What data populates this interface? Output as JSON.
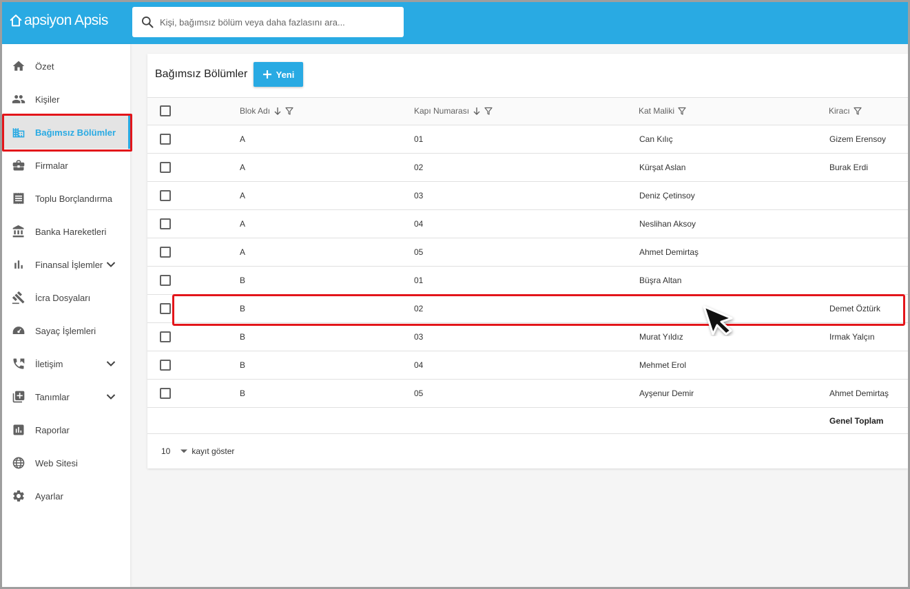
{
  "app": {
    "logo_text": "apsiyon Apsis",
    "brand_color": "#29aae3",
    "highlight_color": "#e3151a"
  },
  "search": {
    "placeholder": "Kişi, bağımsız bölüm veya daha fazlasını ara..."
  },
  "sidebar": {
    "items": [
      {
        "label": "Özet",
        "icon": "home-icon"
      },
      {
        "label": "Kişiler",
        "icon": "people-icon"
      },
      {
        "label": "Bağımsız Bölümler",
        "icon": "building-icon",
        "active": true
      },
      {
        "label": "Firmalar",
        "icon": "briefcase-icon"
      },
      {
        "label": "Toplu Borçlandırma",
        "icon": "receipt-icon"
      },
      {
        "label": "Banka Hareketleri",
        "icon": "bank-icon"
      },
      {
        "label": "Finansal İşlemler",
        "icon": "bar-chart-icon",
        "expandable": true
      },
      {
        "label": "İcra Dosyaları",
        "icon": "gavel-icon"
      },
      {
        "label": "Sayaç İşlemleri",
        "icon": "meter-icon"
      },
      {
        "label": "İletişim",
        "icon": "phone-icon",
        "expandable": true
      },
      {
        "label": "Tanımlar",
        "icon": "library-add-icon",
        "expandable": true
      },
      {
        "label": "Raporlar",
        "icon": "report-icon"
      },
      {
        "label": "Web Sitesi",
        "icon": "globe-icon"
      },
      {
        "label": "Ayarlar",
        "icon": "gear-icon"
      }
    ]
  },
  "main": {
    "title": "Bağımsız Bölümler",
    "new_button_label": "Yeni",
    "columns": [
      "Blok Adı",
      "Kapı Numarası",
      "Kat Maliki",
      "Kiracı"
    ],
    "rows": [
      {
        "blok": "A",
        "kapi": "01",
        "malik": "Can Kılıç",
        "kiraci": "Gizem Erensoy"
      },
      {
        "blok": "A",
        "kapi": "02",
        "malik": "Kürşat Aslan",
        "kiraci": "Burak Erdi"
      },
      {
        "blok": "A",
        "kapi": "03",
        "malik": "Deniz Çetinsoy",
        "kiraci": ""
      },
      {
        "blok": "A",
        "kapi": "04",
        "malik": "Neslihan Aksoy",
        "kiraci": ""
      },
      {
        "blok": "A",
        "kapi": "05",
        "malik": "Ahmet Demirtaş",
        "kiraci": ""
      },
      {
        "blok": "B",
        "kapi": "01",
        "malik": "Büşra Altan",
        "kiraci": ""
      },
      {
        "blok": "B",
        "kapi": "02",
        "malik": "",
        "kiraci": "Demet Öztürk"
      },
      {
        "blok": "B",
        "kapi": "03",
        "malik": "Murat Yıldız",
        "kiraci": "Irmak Yalçın"
      },
      {
        "blok": "B",
        "kapi": "04",
        "malik": "Mehmet Erol",
        "kiraci": ""
      },
      {
        "blok": "B",
        "kapi": "05",
        "malik": "Ayşenur Demir",
        "kiraci": "Ahmet Demirtaş"
      }
    ],
    "total_label": "Genel Toplam",
    "page_size": "10",
    "page_size_label": "kayıt göster"
  }
}
